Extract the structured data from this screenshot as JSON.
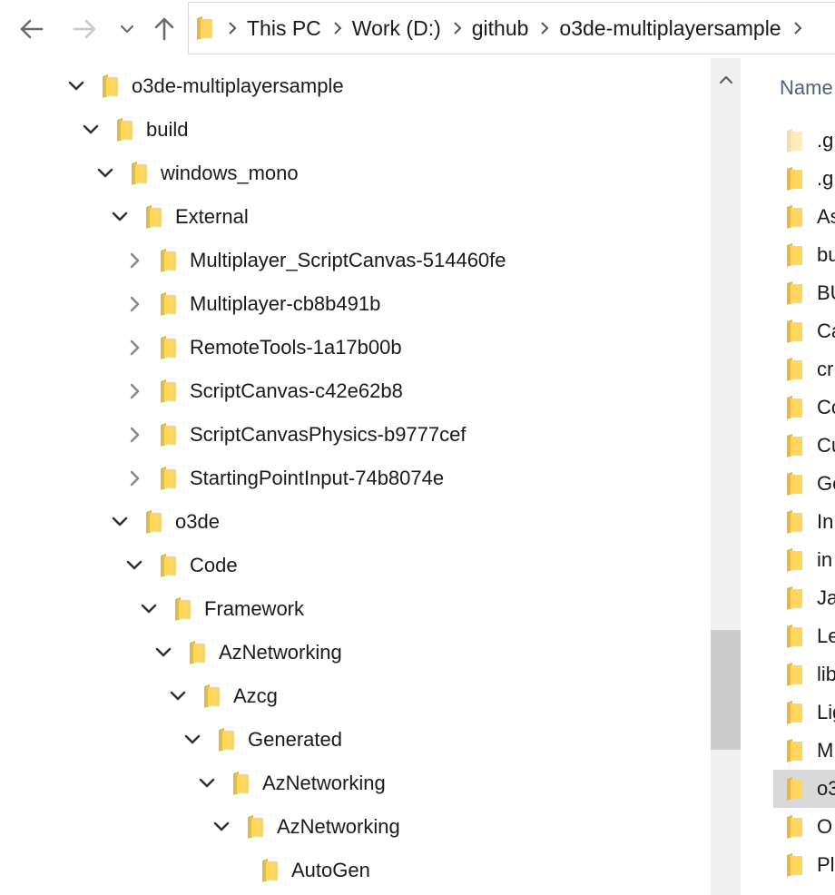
{
  "window": {
    "title": "o3de-multiplayersample"
  },
  "toolbar": {
    "back_icon": "arrow-left-icon",
    "forward_icon": "arrow-right-icon",
    "recent_icon": "chevron-down-icon",
    "up_icon": "arrow-up-icon"
  },
  "address": {
    "crumbs": [
      "This PC",
      "Work (D:)",
      "github",
      "o3de-multiplayersample"
    ]
  },
  "tree": [
    {
      "label": "o3de-multiplayersample",
      "depth": 0,
      "state": "expanded"
    },
    {
      "label": "build",
      "depth": 1,
      "state": "expanded"
    },
    {
      "label": "windows_mono",
      "depth": 2,
      "state": "expanded"
    },
    {
      "label": "External",
      "depth": 3,
      "state": "expanded"
    },
    {
      "label": "Multiplayer_ScriptCanvas-514460fe",
      "depth": 4,
      "state": "collapsed"
    },
    {
      "label": "Multiplayer-cb8b491b",
      "depth": 4,
      "state": "collapsed"
    },
    {
      "label": "RemoteTools-1a17b00b",
      "depth": 4,
      "state": "collapsed"
    },
    {
      "label": "ScriptCanvas-c42e62b8",
      "depth": 4,
      "state": "collapsed"
    },
    {
      "label": "ScriptCanvasPhysics-b9777cef",
      "depth": 4,
      "state": "collapsed"
    },
    {
      "label": "StartingPointInput-74b8074e",
      "depth": 4,
      "state": "collapsed"
    },
    {
      "label": "o3de",
      "depth": 3,
      "state": "expanded"
    },
    {
      "label": "Code",
      "depth": 4,
      "state": "expanded"
    },
    {
      "label": "Framework",
      "depth": 5,
      "state": "expanded"
    },
    {
      "label": "AzNetworking",
      "depth": 6,
      "state": "expanded"
    },
    {
      "label": "Azcg",
      "depth": 7,
      "state": "expanded"
    },
    {
      "label": "Generated",
      "depth": 8,
      "state": "expanded"
    },
    {
      "label": "AzNetworking",
      "depth": 9,
      "state": "expanded"
    },
    {
      "label": "AzNetworking",
      "depth": 10,
      "state": "expanded"
    },
    {
      "label": "AutoGen",
      "depth": 11,
      "state": "none"
    }
  ],
  "scrollbar": {
    "up_icon": "chevron-up-icon",
    "position_fraction": 0.69
  },
  "filelist": {
    "column_header": "Name",
    "items": [
      {
        "label": ".g",
        "hidden": true,
        "selected": false
      },
      {
        "label": ".g",
        "hidden": false,
        "selected": false
      },
      {
        "label": "As",
        "hidden": false,
        "selected": false
      },
      {
        "label": "bu",
        "hidden": false,
        "selected": false
      },
      {
        "label": "BU",
        "hidden": false,
        "selected": false
      },
      {
        "label": "Ca",
        "hidden": false,
        "selected": false
      },
      {
        "label": "cr",
        "hidden": false,
        "selected": false
      },
      {
        "label": "Co",
        "hidden": false,
        "selected": false
      },
      {
        "label": "Cu",
        "hidden": false,
        "selected": false
      },
      {
        "label": "Ge",
        "hidden": false,
        "selected": false
      },
      {
        "label": "In",
        "hidden": false,
        "selected": false
      },
      {
        "label": "in",
        "hidden": false,
        "selected": false
      },
      {
        "label": "Ja",
        "hidden": false,
        "selected": false
      },
      {
        "label": "Le",
        "hidden": false,
        "selected": false
      },
      {
        "label": "lib",
        "hidden": false,
        "selected": false
      },
      {
        "label": "Lig",
        "hidden": false,
        "selected": false
      },
      {
        "label": "M",
        "hidden": false,
        "selected": false
      },
      {
        "label": "o3",
        "hidden": false,
        "selected": true
      },
      {
        "label": "O",
        "hidden": false,
        "selected": false
      },
      {
        "label": "Pl",
        "hidden": false,
        "selected": false
      }
    ]
  },
  "colors": {
    "folder_front": "#FFD75E",
    "folder_back": "#E9B642",
    "selection": "#D9D9D9",
    "header_text": "#4A6380"
  }
}
